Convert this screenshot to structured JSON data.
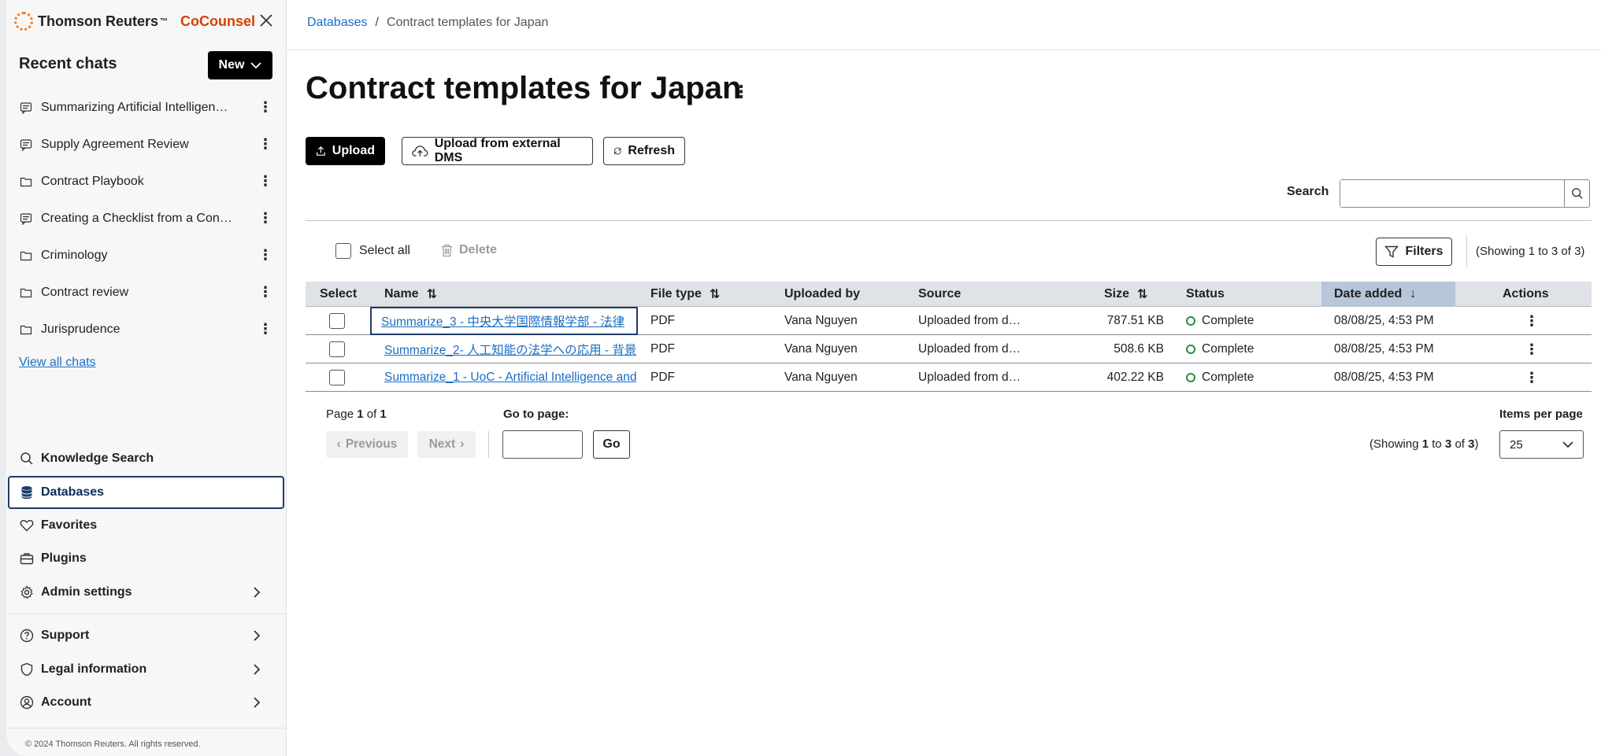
{
  "brand": {
    "name": "Thomson Reuters",
    "tm": "™",
    "product": "CoCounsel"
  },
  "sidebar": {
    "recent_title": "Recent chats",
    "new_label": "New",
    "chats": [
      {
        "label": "Summarizing Artificial Intelligen…",
        "icon": "chat-icon"
      },
      {
        "label": "Supply Agreement Review",
        "icon": "chat-icon"
      },
      {
        "label": "Contract Playbook",
        "icon": "folder-icon"
      },
      {
        "label": "Creating a Checklist from a Contr…",
        "icon": "chat-icon"
      },
      {
        "label": "Criminology",
        "icon": "folder-icon"
      },
      {
        "label": "Contract review",
        "icon": "folder-icon"
      },
      {
        "label": "Jurisprudence",
        "icon": "folder-icon"
      }
    ],
    "view_all": "View all chats",
    "nav": {
      "knowledge_search": "Knowledge Search",
      "databases": "Databases",
      "favorites": "Favorites",
      "plugins": "Plugins",
      "admin_settings": "Admin settings",
      "support": "Support",
      "legal_information": "Legal information",
      "account": "Account"
    },
    "copyright": "© 2024 Thomson Reuters. All rights reserved."
  },
  "breadcrumb": {
    "root": "Databases",
    "separator": "/",
    "current": "Contract templates for Japan"
  },
  "page": {
    "title": "Contract templates for Japan",
    "upload": "Upload",
    "upload_external": "Upload from external DMS",
    "refresh": "Refresh",
    "search_label": "Search",
    "search_value": "",
    "select_all": "Select all",
    "delete": "Delete",
    "filters": "Filters",
    "showing_top": "(Showing 1 to 3 of 3)"
  },
  "table": {
    "columns": {
      "select": "Select",
      "name": "Name",
      "file_type": "File type",
      "uploaded_by": "Uploaded by",
      "source": "Source",
      "size": "Size",
      "status": "Status",
      "date_added": "Date added",
      "actions": "Actions"
    },
    "rows": [
      {
        "name": "Summarize_3 - 中央大学国際情報学部 - 法律",
        "file_type": "PDF",
        "uploaded_by": "Vana Nguyen",
        "source": "Uploaded from d…",
        "size": "787.51 KB",
        "status": "Complete",
        "date_added": "08/08/25, 4:53 PM"
      },
      {
        "name": "Summarize_2- 人工知能の法学への応用 - 背景",
        "file_type": "PDF",
        "uploaded_by": "Vana Nguyen",
        "source": "Uploaded from d…",
        "size": "508.6 KB",
        "status": "Complete",
        "date_added": "08/08/25, 4:53 PM"
      },
      {
        "name": "Summarize_1 - UoC - Artificial Intelligence and",
        "file_type": "PDF",
        "uploaded_by": "Vana Nguyen",
        "source": "Uploaded from d…",
        "size": "402.22 KB",
        "status": "Complete",
        "date_added": "08/08/25, 4:53 PM"
      }
    ]
  },
  "pagination": {
    "page_word": "Page",
    "page_current": "1",
    "of_word": "of",
    "page_total": "1",
    "previous": "Previous",
    "next": "Next",
    "goto_label": "Go to page:",
    "goto_value": "",
    "go": "Go",
    "showing_prefix": "(Showing",
    "showing_from": "1",
    "to_word": "to",
    "showing_to": "3",
    "showing_total": "3",
    "showing_suffix": ")",
    "items_per_page_label": "Items per page",
    "items_per_page_value": "25"
  },
  "colors": {
    "accent": "#d64000",
    "link": "#1a6ec2",
    "active_border": "#1d3c6b",
    "status_complete": "#2e8b3e"
  }
}
